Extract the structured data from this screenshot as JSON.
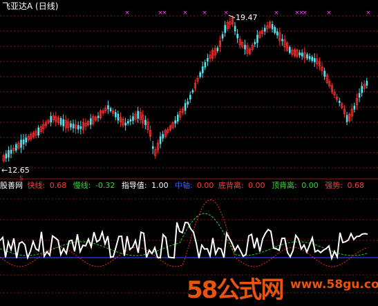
{
  "window": {
    "title": "飞亚达A (日线)"
  },
  "price_chart": {
    "high_label": "19.47",
    "low_label": "12.65",
    "low_marker": "S",
    "colors": {
      "up": "#ff3030",
      "down": "#54e6f0",
      "grid": "#8b1a1a",
      "marker": "#ff40ff"
    }
  },
  "indicator": {
    "name": "股善网",
    "fast_label": "快线:",
    "fast_value": "0.68",
    "slow_label": "慢线:",
    "slow_value": "-0.32",
    "guide_label": "指导值:",
    "guide_value": "1.00",
    "axis_label": "中轴:",
    "axis_value": "0.00",
    "bottom_div_label": "底背离:",
    "bottom_div_value": "0.00",
    "top_div_label": "顶背离:",
    "top_div_value": "0.00",
    "strength_label": "强势:",
    "strength_value": "0.68"
  },
  "watermark": {
    "brand": "58公式网",
    "url": "www.58gu.com"
  }
}
